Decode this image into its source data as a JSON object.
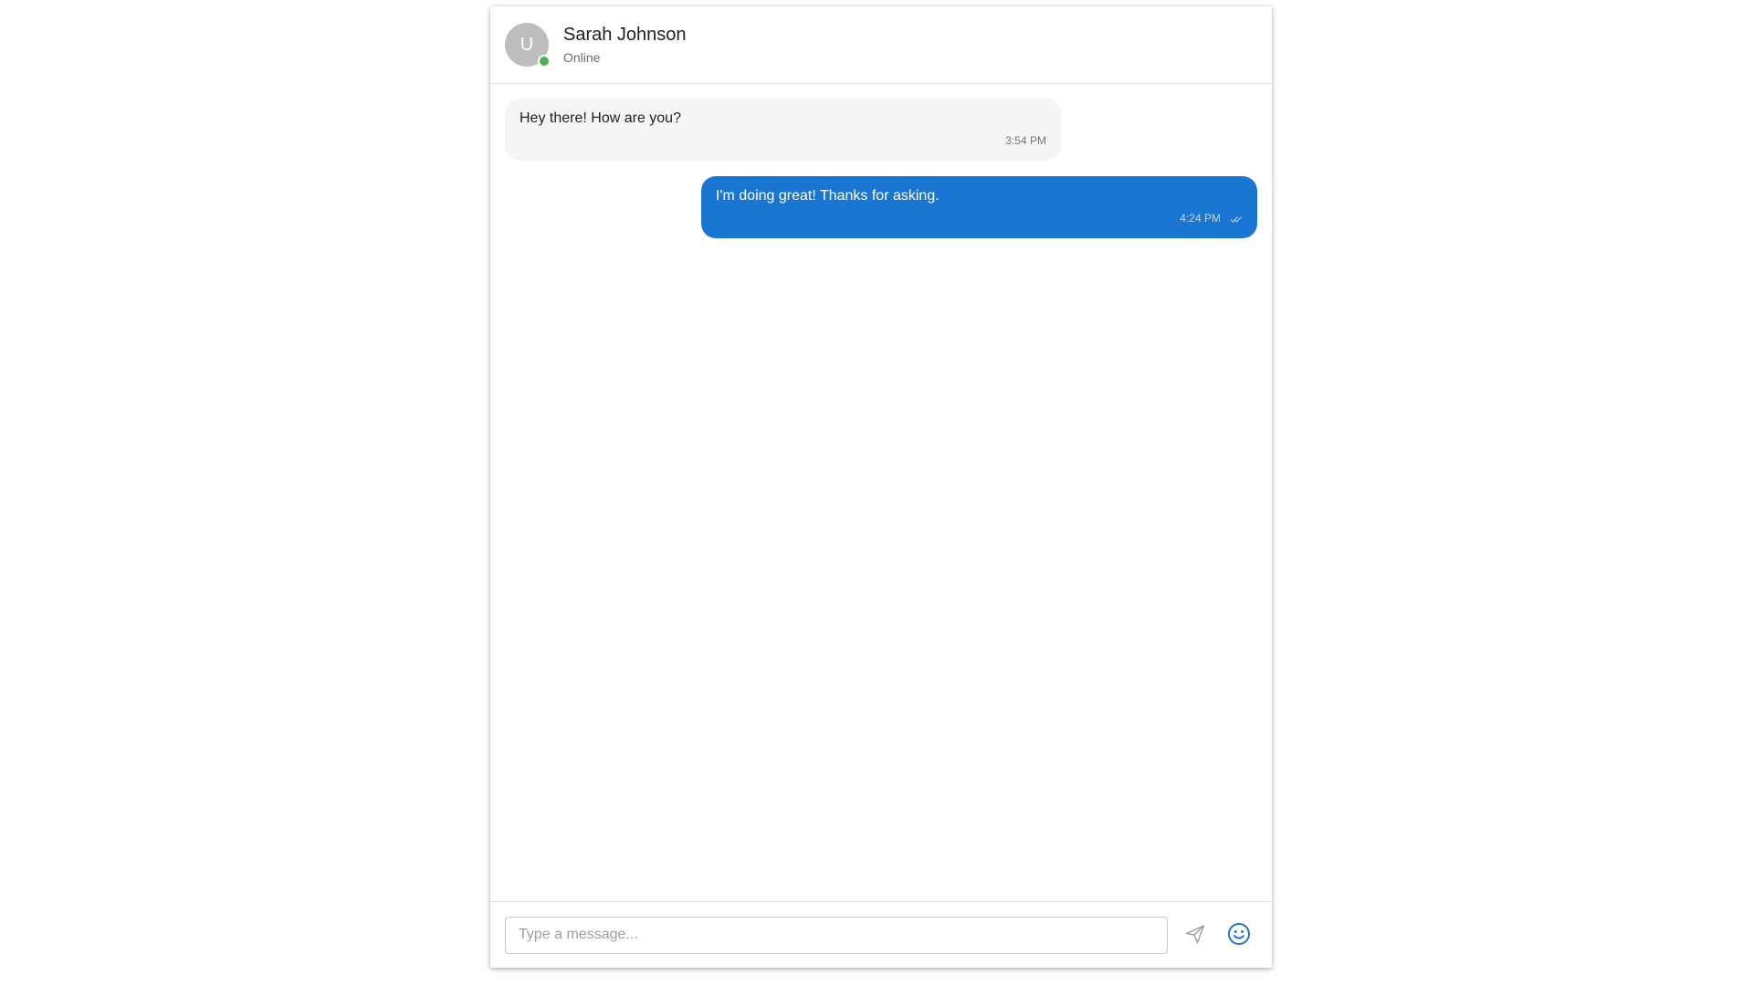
{
  "contact": {
    "avatar_initial": "U",
    "name": "Sarah Johnson",
    "status": "Online",
    "presence_color": "#4caf50"
  },
  "messages": [
    {
      "direction": "received",
      "text": "Hey there! How are you?",
      "time": "3:54 PM"
    },
    {
      "direction": "sent",
      "text": "I'm doing great! Thanks for asking.",
      "time": "4:24 PM",
      "read_receipt_icon": "double-check-icon"
    }
  ],
  "composer": {
    "placeholder": "Type a message...",
    "value": "",
    "send_icon": "send-icon",
    "emoji_icon": "emoji-smile-icon"
  },
  "colors": {
    "accent": "#1976d2",
    "received_bubble": "#f5f5f5",
    "avatar_bg": "#bdbdbd"
  }
}
